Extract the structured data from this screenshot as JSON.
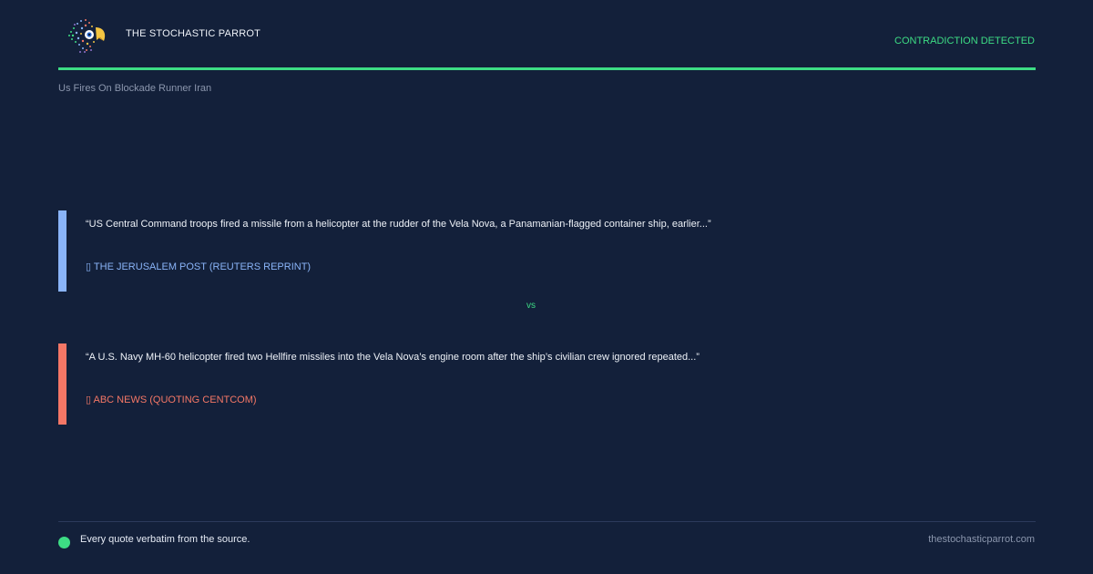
{
  "header": {
    "brand": "THE STOCHASTIC PARROT",
    "status": "CONTRADICTION DETECTED",
    "logo_icon": "parrot-logo-icon"
  },
  "headline": "Us Fires On Blockade Runner Iran",
  "quotes": [
    {
      "text": "“US Central Command troops fired a missile from a helicopter at the rudder of the Vela Nova, a Panamanian-flagged container ship, earlier...”",
      "source": "▯ THE JERUSALEM POST (REUTERS REPRINT)",
      "color": "#8ab4f8"
    },
    {
      "text": "“A U.S. Navy MH-60 helicopter fired two Hellfire missiles into the Vela Nova’s engine room after the ship’s civilian crew ignored repeated...”",
      "source": "▯ ABC NEWS (QUOTING CENTCOM)",
      "color": "#f47766"
    }
  ],
  "separator": "vs",
  "footer": {
    "note": "Every quote verbatim from the source.",
    "site": "thestochasticparrot.com"
  },
  "colors": {
    "background": "#13203a",
    "accent": "#3ddc84"
  }
}
